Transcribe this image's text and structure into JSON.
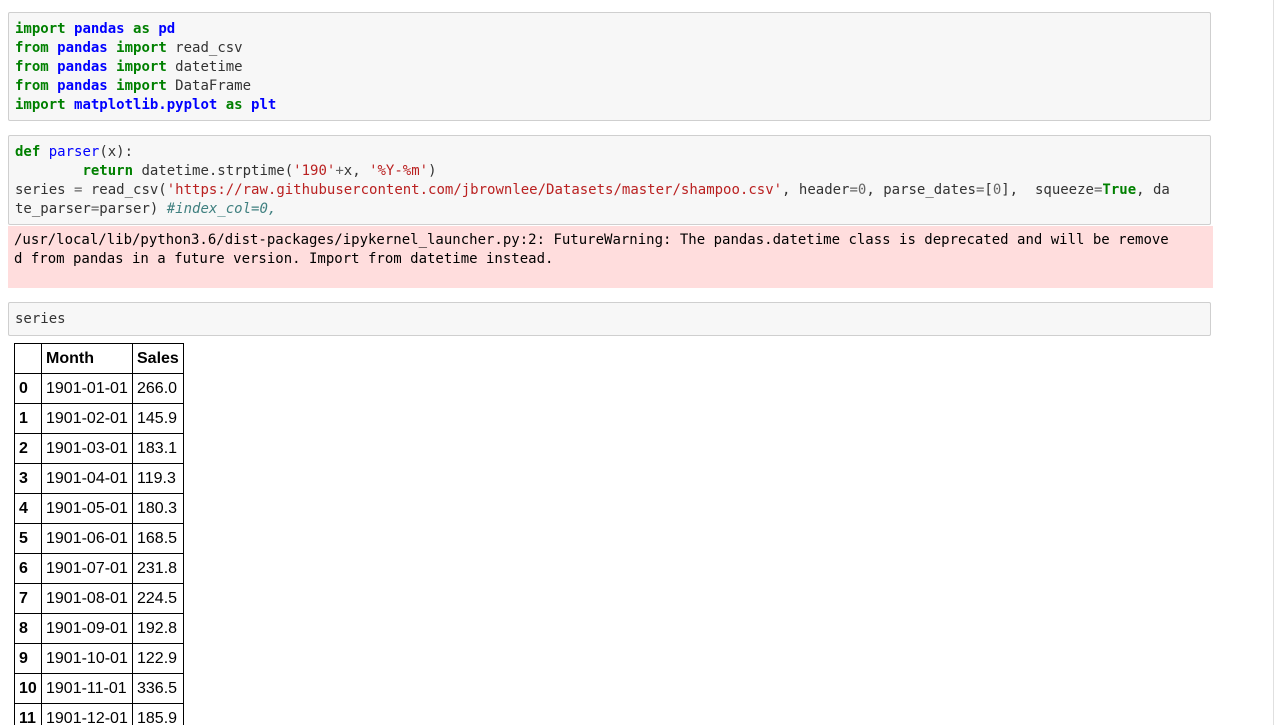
{
  "cells": {
    "imports": [
      [
        {
          "t": "import",
          "c": "kw"
        },
        {
          "t": " "
        },
        {
          "t": "pandas",
          "c": "nn"
        },
        {
          "t": " "
        },
        {
          "t": "as",
          "c": "kw"
        },
        {
          "t": " "
        },
        {
          "t": "pd",
          "c": "nn"
        }
      ],
      [
        {
          "t": "from",
          "c": "kw"
        },
        {
          "t": " "
        },
        {
          "t": "pandas",
          "c": "nn"
        },
        {
          "t": " "
        },
        {
          "t": "import",
          "c": "kw"
        },
        {
          "t": " read_csv"
        }
      ],
      [
        {
          "t": "from",
          "c": "kw"
        },
        {
          "t": " "
        },
        {
          "t": "pandas",
          "c": "nn"
        },
        {
          "t": " "
        },
        {
          "t": "import",
          "c": "kw"
        },
        {
          "t": " datetime"
        }
      ],
      [
        {
          "t": "from",
          "c": "kw"
        },
        {
          "t": " "
        },
        {
          "t": "pandas",
          "c": "nn"
        },
        {
          "t": " "
        },
        {
          "t": "import",
          "c": "kw"
        },
        {
          "t": " DataFrame"
        }
      ],
      [
        {
          "t": "import",
          "c": "kw"
        },
        {
          "t": " "
        },
        {
          "t": "matplotlib.pyplot",
          "c": "nn"
        },
        {
          "t": " "
        },
        {
          "t": "as",
          "c": "kw"
        },
        {
          "t": " "
        },
        {
          "t": "plt",
          "c": "nn"
        }
      ]
    ],
    "parser": [
      [
        {
          "t": "def",
          "c": "kw"
        },
        {
          "t": " "
        },
        {
          "t": "parser",
          "c": "nf"
        },
        {
          "t": "(x):"
        }
      ],
      [
        {
          "t": "        "
        },
        {
          "t": "return",
          "c": "kw"
        },
        {
          "t": " datetime.strptime("
        },
        {
          "t": "'190'",
          "c": "s"
        },
        {
          "t": "+",
          "c": "o"
        },
        {
          "t": "x, "
        },
        {
          "t": "'%Y-%m'",
          "c": "s"
        },
        {
          "t": ")"
        }
      ],
      [
        {
          "t": "series "
        },
        {
          "t": "=",
          "c": "o"
        },
        {
          "t": " read_csv("
        },
        {
          "t": "'https://raw.githubusercontent.com/jbrownlee/Datasets/master/shampoo.csv'",
          "c": "s"
        },
        {
          "t": ", header"
        },
        {
          "t": "=",
          "c": "o"
        },
        {
          "t": "0",
          "c": "mi"
        },
        {
          "t": ", parse_dates"
        },
        {
          "t": "=",
          "c": "o"
        },
        {
          "t": "["
        },
        {
          "t": "0",
          "c": "mi"
        },
        {
          "t": "],  squeeze"
        },
        {
          "t": "=",
          "c": "o"
        },
        {
          "t": "True",
          "c": "kw"
        },
        {
          "t": ", da"
        }
      ],
      [
        {
          "t": "te_parser"
        },
        {
          "t": "=",
          "c": "o"
        },
        {
          "t": "parser) "
        },
        {
          "t": "#index_col=0,",
          "c": "c"
        }
      ]
    ],
    "series": [
      [
        {
          "t": "series"
        }
      ]
    ]
  },
  "warning": {
    "line1": "/usr/local/lib/python3.6/dist-packages/ipykernel_launcher.py:2: FutureWarning: The pandas.datetime class is deprecated and will be remove",
    "line2": "d from pandas in a future version. Import from datetime instead."
  },
  "table": {
    "columns": [
      "",
      "Month",
      "Sales"
    ],
    "rows": [
      [
        "0",
        "1901-01-01",
        "266.0"
      ],
      [
        "1",
        "1901-02-01",
        "145.9"
      ],
      [
        "2",
        "1901-03-01",
        "183.1"
      ],
      [
        "3",
        "1901-04-01",
        "119.3"
      ],
      [
        "4",
        "1901-05-01",
        "180.3"
      ],
      [
        "5",
        "1901-06-01",
        "168.5"
      ],
      [
        "6",
        "1901-07-01",
        "231.8"
      ],
      [
        "7",
        "1901-08-01",
        "224.5"
      ],
      [
        "8",
        "1901-09-01",
        "192.8"
      ],
      [
        "9",
        "1901-10-01",
        "122.9"
      ],
      [
        "10",
        "1901-11-01",
        "336.5"
      ],
      [
        "11",
        "1901-12-01",
        "185.9"
      ]
    ]
  }
}
